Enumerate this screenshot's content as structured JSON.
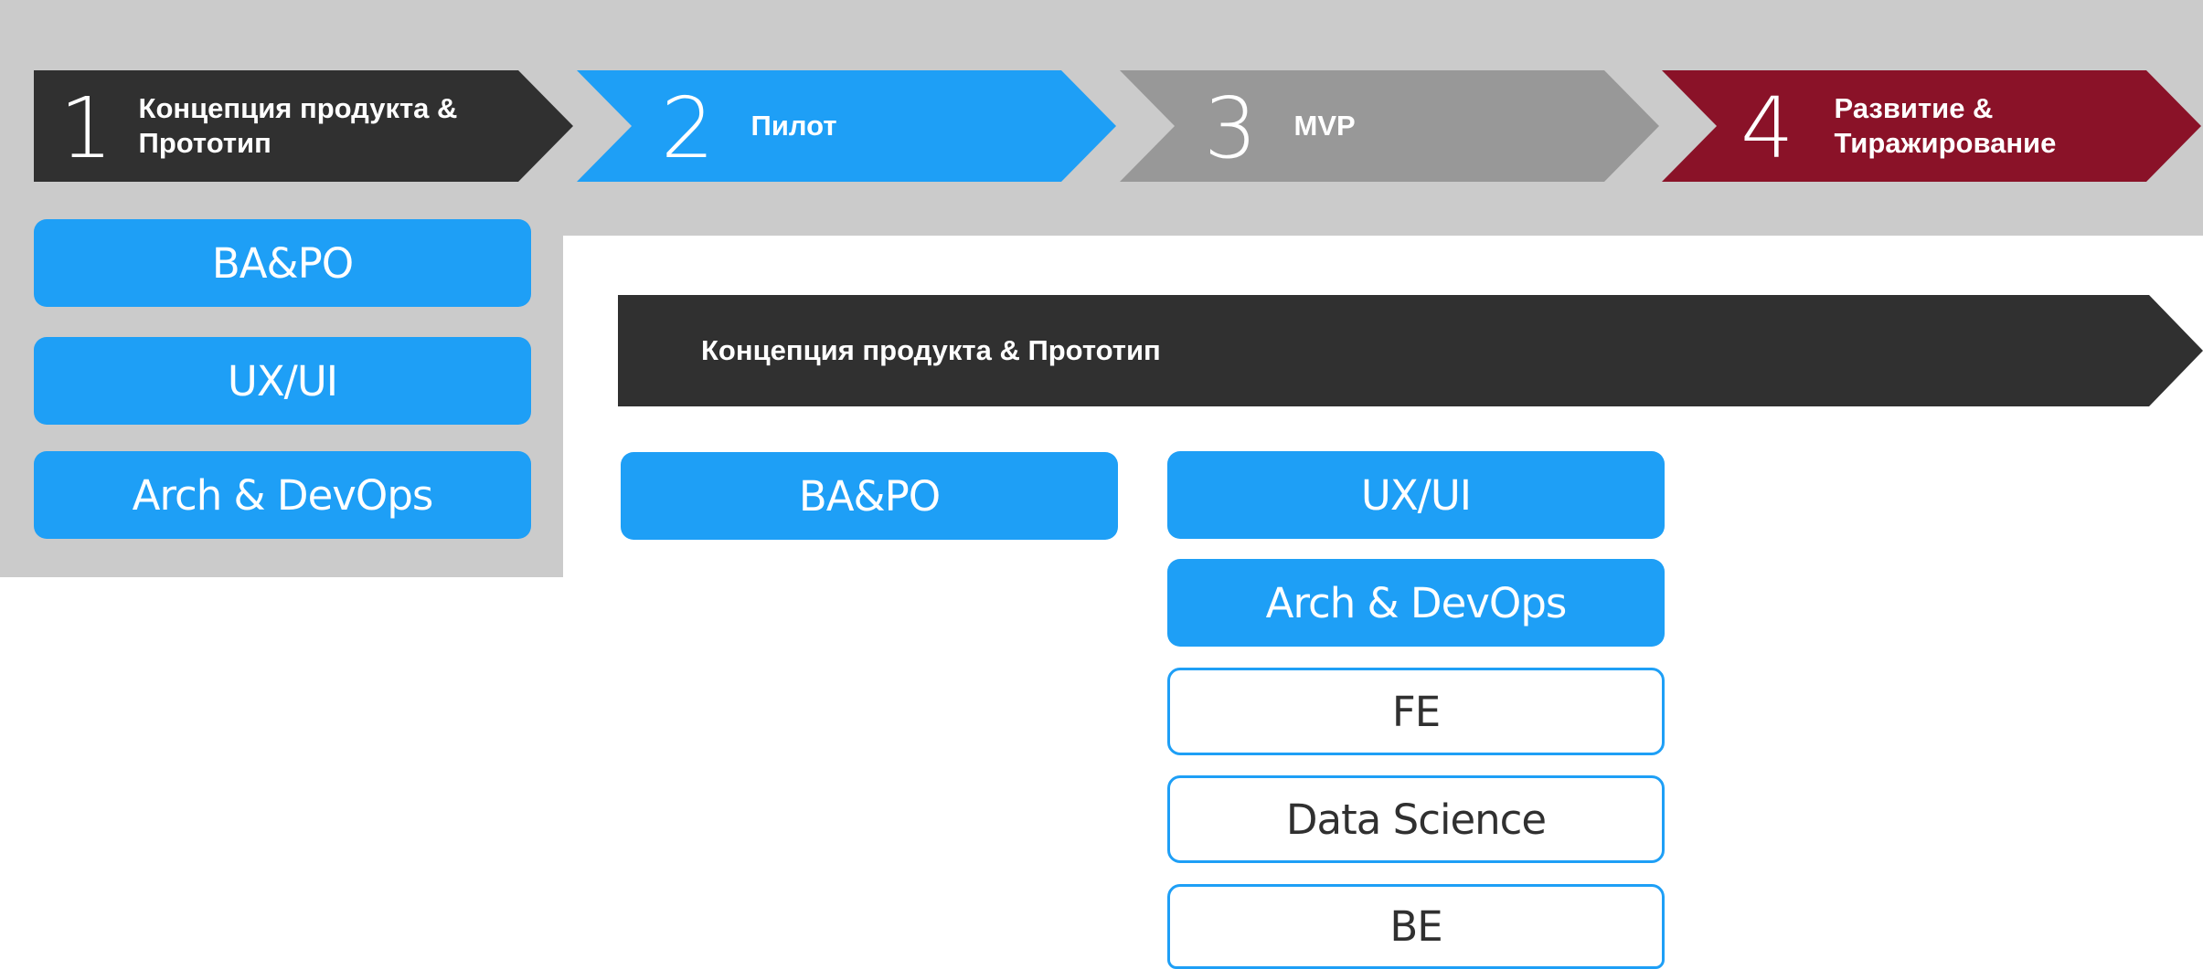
{
  "stages": [
    {
      "number": "1",
      "label": "Концепция продукта &\nПрототип",
      "color": "#303030"
    },
    {
      "number": "2",
      "label": "Пилот",
      "color": "#1e9ff6"
    },
    {
      "number": "3",
      "label": "MVP",
      "color": "#989898"
    },
    {
      "number": "4",
      "label": "Развитие  &\nТиражирование",
      "color": "#8a1228"
    }
  ],
  "left_roles": [
    "BA&PO",
    "UX/UI",
    "Arch & DevOps"
  ],
  "arrow": {
    "label": "Концепция продукта & Прототип"
  },
  "middle_roles": [
    "BA&PO"
  ],
  "right_roles_filled": [
    "UX/UI",
    "Arch & DevOps"
  ],
  "right_roles_outline": [
    "FE",
    "Data Science",
    "BE"
  ],
  "colors": {
    "accent_blue": "#1e9ff6",
    "dark": "#303030",
    "grey": "#989898",
    "burgundy": "#8a1228",
    "backdrop": "#cbcbcb"
  }
}
